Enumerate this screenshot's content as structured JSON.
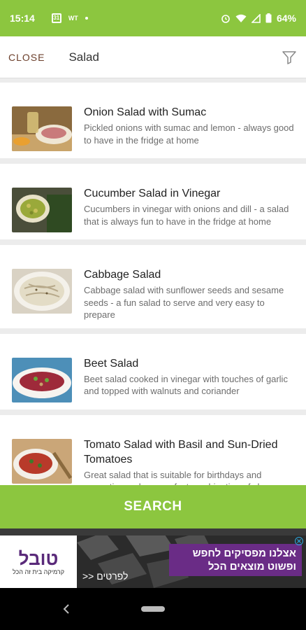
{
  "status_bar": {
    "time": "15:14",
    "calendar_day": "31",
    "wt": "WT",
    "battery": "64%"
  },
  "header": {
    "close_label": "CLOSE",
    "query": "Salad"
  },
  "recipes": [
    {
      "title": "Onion Salad with Sumac",
      "description": "Pickled onions with sumac and lemon - always good to have in the fridge at home"
    },
    {
      "title": "Cucumber Salad in Vinegar",
      "description": "Cucumbers in vinegar with onions and dill - a salad that is always fun to have in the fridge at home"
    },
    {
      "title": "Cabbage Salad",
      "description": "Cabbage salad with sunflower seeds and sesame seeds - a fun salad to serve and very easy to prepare"
    },
    {
      "title": "Beet Salad",
      "description": "Beet salad cooked in vinegar with touches of garlic and topped with walnuts and coriander"
    },
    {
      "title": "Tomato Salad with Basil and Sun-Dried Tomatoes",
      "description": "Great salad that is suitable for birthdays and romantic meals - a perfect combination of cherry tomatoes with fresh basil, sun-dried"
    }
  ],
  "search_button": {
    "label": "SEARCH"
  },
  "ad": {
    "logo_text": "טובל",
    "logo_sub": "קרמיקה בית זה הכל",
    "headline": "אצלנו מפסיקים לחפש ופשוט מוצאים הכל",
    "cta": "לפרטים <<"
  },
  "colors": {
    "accent": "#8cc63f",
    "close_text": "#6b3e2a",
    "ad_purple": "#6a2c86"
  }
}
